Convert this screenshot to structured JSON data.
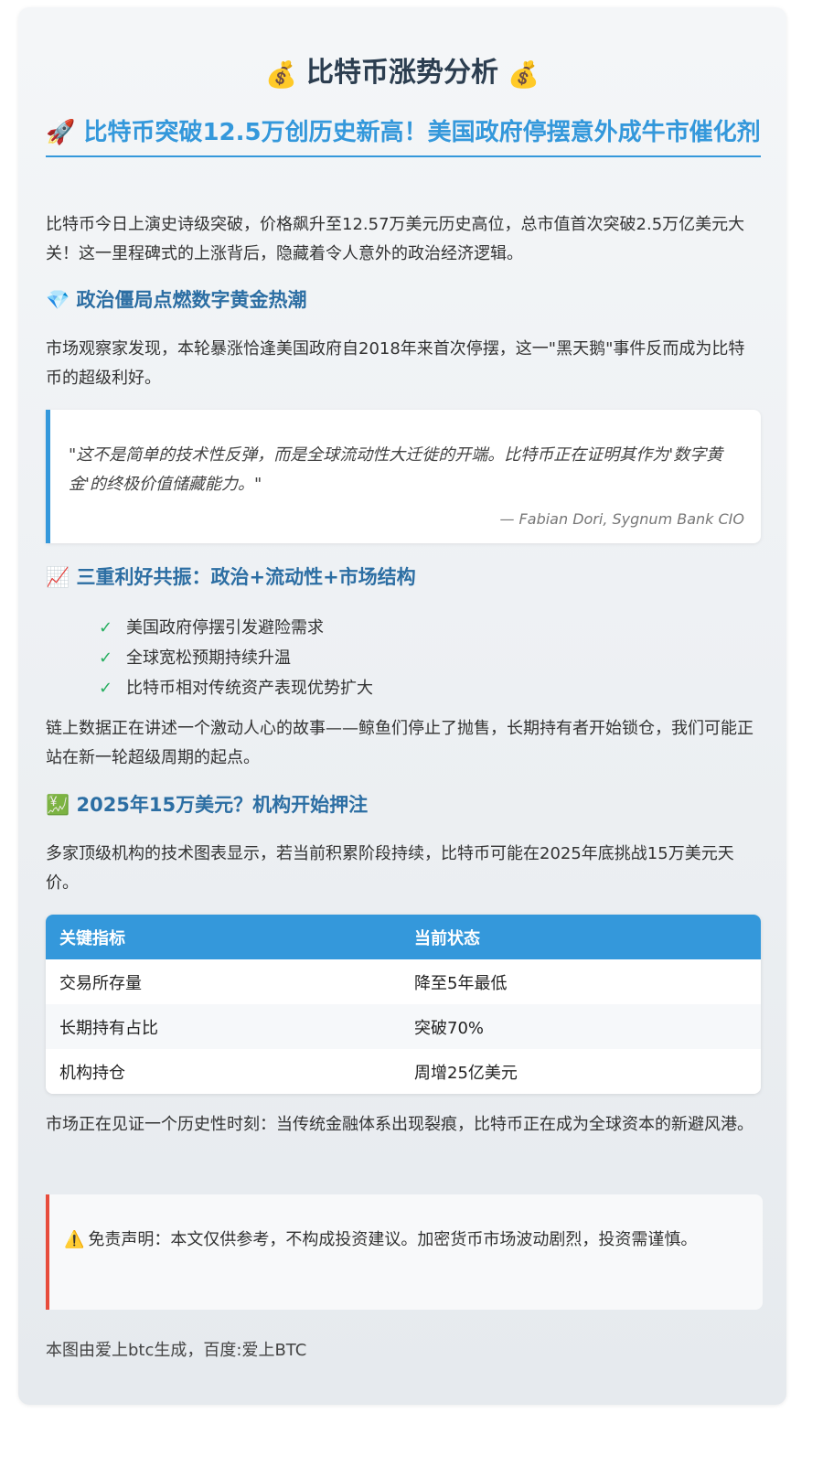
{
  "header": {
    "title": "比特币涨势分析",
    "left_icon": "money-bag-icon",
    "right_icon": "money-bag-icon",
    "icon_glyph": "💰"
  },
  "article": {
    "headline_icon": "🚀",
    "headline": "比特币突破12.5万创历史新高！美国政府停摆意外成牛市催化剂",
    "intro": "比特币今日上演史诗级突破，价格飙升至12.57万美元历史高位，总市值首次突破2.5万亿美元大关！这一里程碑式的上涨背后，隐藏着令人意外的政治经济逻辑。",
    "section1": {
      "icon": "💎",
      "title": "政治僵局点燃数字黄金热潮",
      "body": "市场观察家发现，本轮暴涨恰逢美国政府自2018年来首次停摆，这一\"黑天鹅\"事件反而成为比特币的超级利好。"
    },
    "quote": {
      "text": "\"这不是简单的技术性反弹，而是全球流动性大迁徙的开端。比特币正在证明其作为'数字黄金'的终极价值储藏能力。\"",
      "author": "— Fabian Dori, Sygnum Bank CIO"
    },
    "section2": {
      "icon": "📈",
      "title": "三重利好共振：政治+流动性+市场结构",
      "check_glyph": "✓",
      "items": [
        "美国政府停摆引发避险需求",
        "全球宽松预期持续升温",
        "比特币相对传统资产表现优势扩大"
      ],
      "body": "链上数据正在讲述一个激动人心的故事——鲸鱼们停止了抛售，长期持有者开始锁仓，我们可能正站在新一轮超级周期的起点。"
    },
    "section3": {
      "icon": "💹",
      "title": "2025年15万美元？机构开始押注",
      "body": "多家顶级机构的技术图表显示，若当前积累阶段持续，比特币可能在2025年底挑战15万美元天价。"
    },
    "table": {
      "headers": [
        "关键指标",
        "当前状态"
      ],
      "rows": [
        [
          "交易所存量",
          "降至5年最低"
        ],
        [
          "长期持有占比",
          "突破70%"
        ],
        [
          "机构持仓",
          "周增25亿美元"
        ]
      ]
    },
    "conclusion": "市场正在见证一个历史性时刻：当传统金融体系出现裂痕，比特币正在成为全球资本的新避风港。",
    "disclaimer": {
      "icon": "⚠️",
      "text": "免责声明：本文仅供参考，不构成投资建议。加密货币市场波动剧烈，投资需谨慎。"
    },
    "footer": "本图由爱上btc生成，百度:爱上BTC"
  },
  "colors": {
    "accent": "#3498db",
    "heading": "#2c3e50",
    "warning": "#e74c3c",
    "check": "#27ae60"
  }
}
